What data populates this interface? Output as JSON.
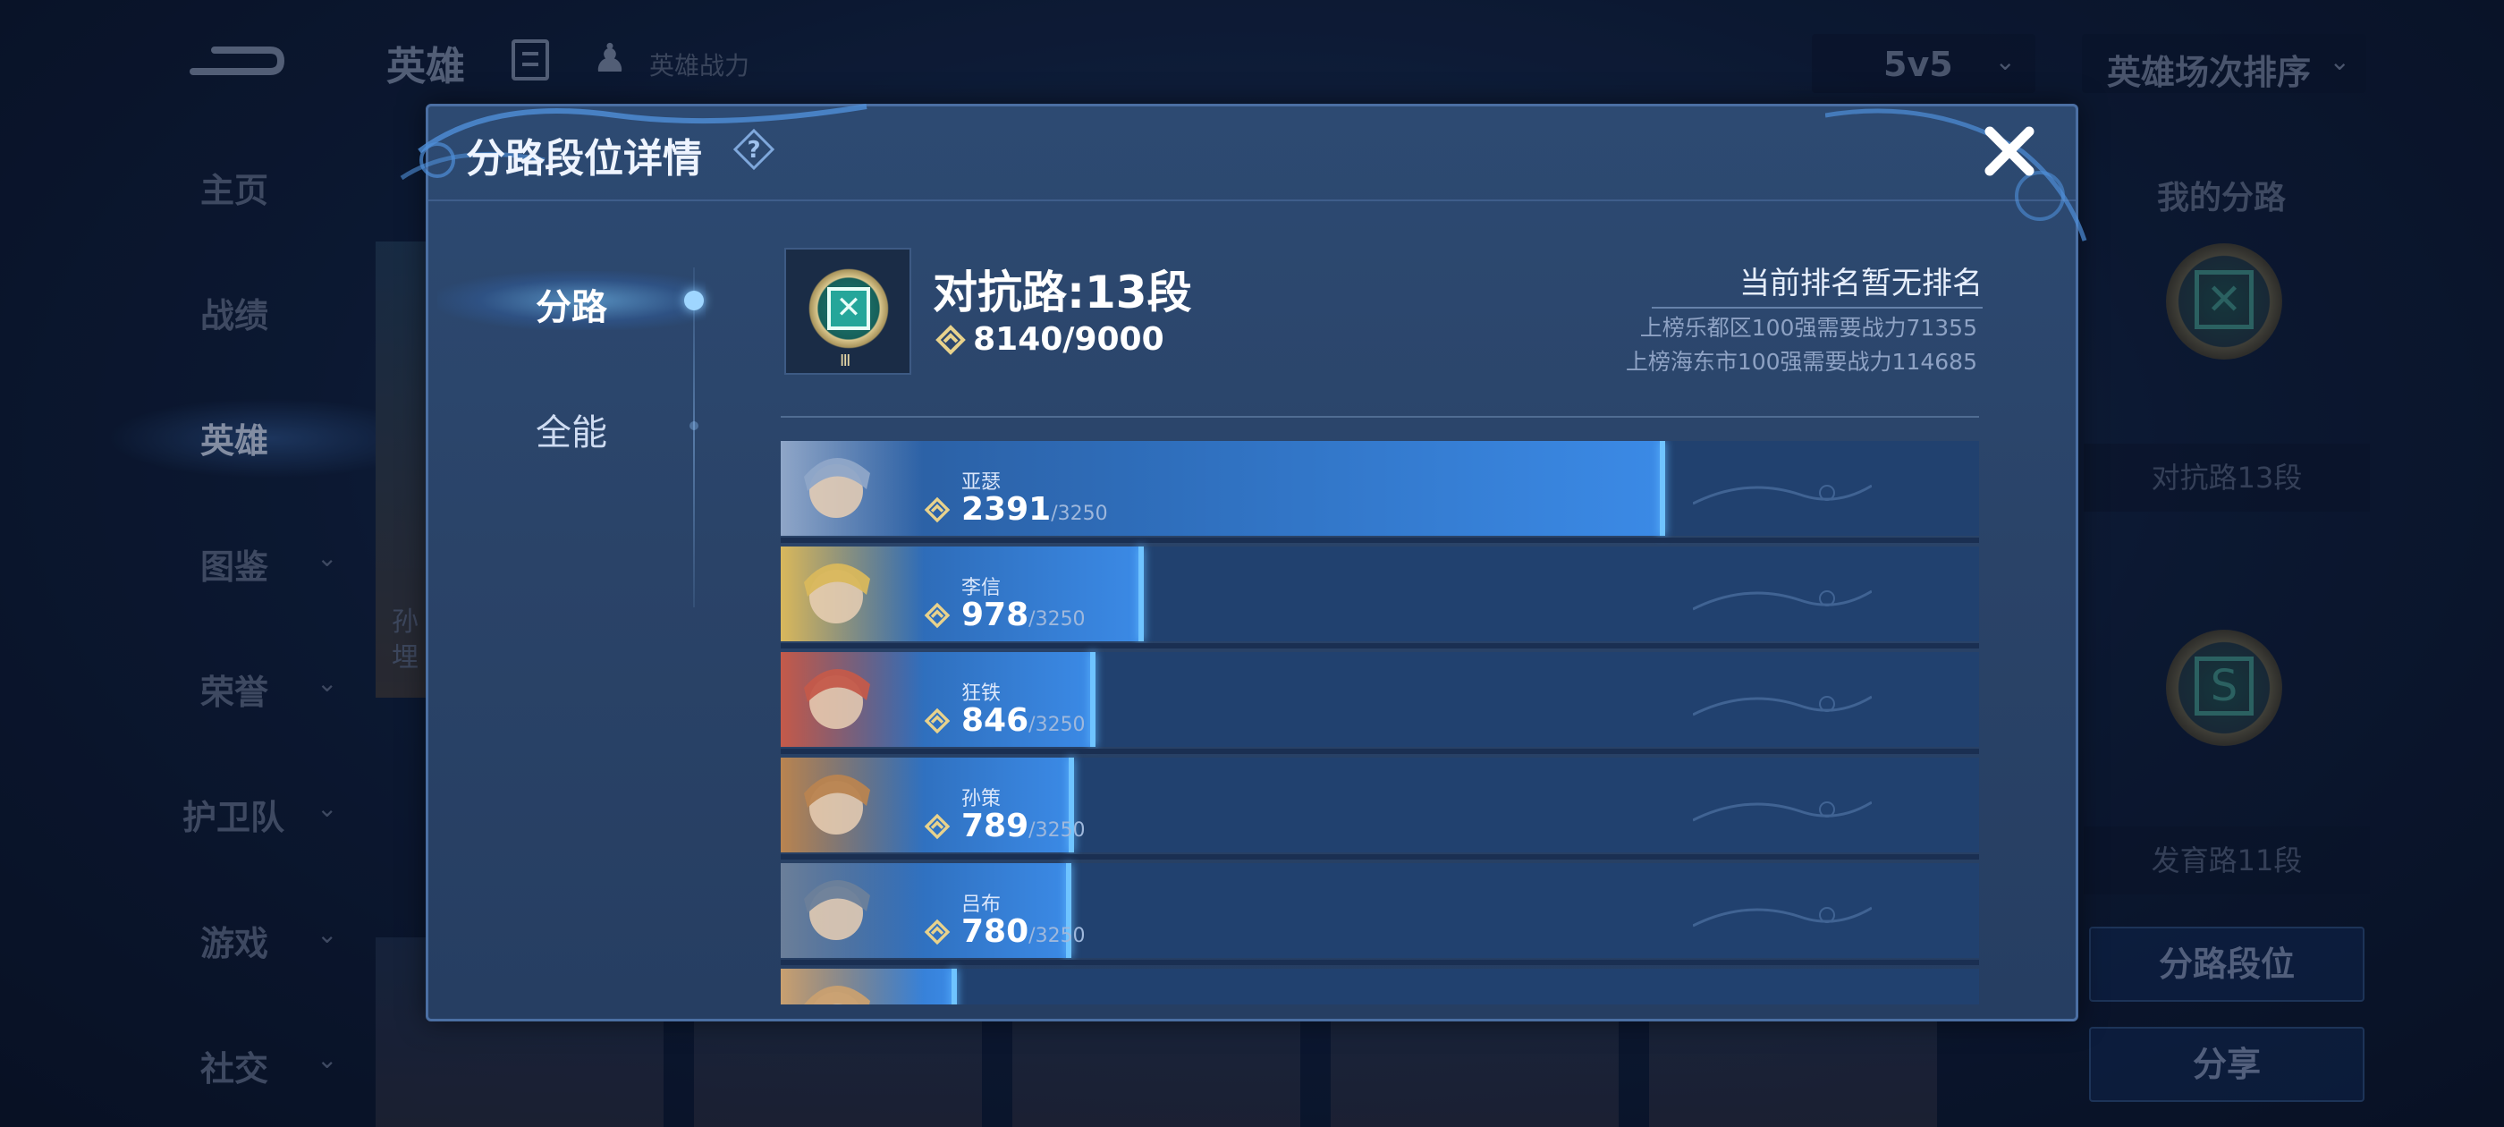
{
  "background": {
    "page_title": "英雄",
    "hero_power_label": "英雄战力",
    "mode_select": {
      "value": "5v5"
    },
    "sort_select": {
      "value": "英雄场次排序"
    },
    "nav": [
      {
        "label": "主页",
        "has_chevron": false
      },
      {
        "label": "战绩",
        "has_chevron": false
      },
      {
        "label": "英雄",
        "has_chevron": false,
        "active": true
      },
      {
        "label": "图鉴",
        "has_chevron": true
      },
      {
        "label": "荣誉",
        "has_chevron": true
      },
      {
        "label": "护卫队",
        "has_chevron": true
      },
      {
        "label": "游戏",
        "has_chevron": true
      },
      {
        "label": "社交",
        "has_chevron": true
      }
    ],
    "right_panel": {
      "title": "我的分路",
      "lanes": [
        {
          "label": "对抗路13段",
          "icon": "crossed-swords-icon"
        },
        {
          "label": "发育路11段",
          "icon": "s-emblem-icon"
        }
      ],
      "lane_rank_button": "分路段位",
      "share_button": "分享"
    },
    "partial_card_text": [
      "孙",
      "埋"
    ]
  },
  "modal": {
    "title": "分路段位详情",
    "tabs": [
      {
        "label": "分路",
        "active": true
      },
      {
        "label": "全能",
        "active": false
      }
    ],
    "summary": {
      "lane_title": "对抗路:13段",
      "badge_roman": "Ⅲ",
      "power_text": "8140/9000",
      "rank_status": "当前排名暂无排名",
      "rank_requirements": [
        "上榜乐都区100强需要战力71355",
        "上榜海东市100强需要战力114685"
      ]
    },
    "heroes": [
      {
        "name": "亚瑟",
        "score": "2391",
        "max": "/3250",
        "progress": 0.7357,
        "avatar_hue": "#8fa6c8"
      },
      {
        "name": "李信",
        "score": "978",
        "max": "/3250",
        "progress": 0.3009,
        "avatar_hue": "#d9b85c"
      },
      {
        "name": "狂铁",
        "score": "846",
        "max": "/3250",
        "progress": 0.2603,
        "avatar_hue": "#c45a4a"
      },
      {
        "name": "孙策",
        "score": "789",
        "max": "/3250",
        "progress": 0.2428,
        "avatar_hue": "#b98450"
      },
      {
        "name": "吕布",
        "score": "780",
        "max": "/3250",
        "progress": 0.24,
        "avatar_hue": "#6b7f9a"
      },
      {
        "name": "",
        "score": "",
        "max": "",
        "progress": 0.145,
        "avatar_hue": "#c9a070"
      }
    ]
  },
  "colors": {
    "accent_blue": "#3b8ae6",
    "bar_edge": "#6fc4ff",
    "lane_teal": "#25a69a",
    "modal_bg": "#2d4a72"
  }
}
